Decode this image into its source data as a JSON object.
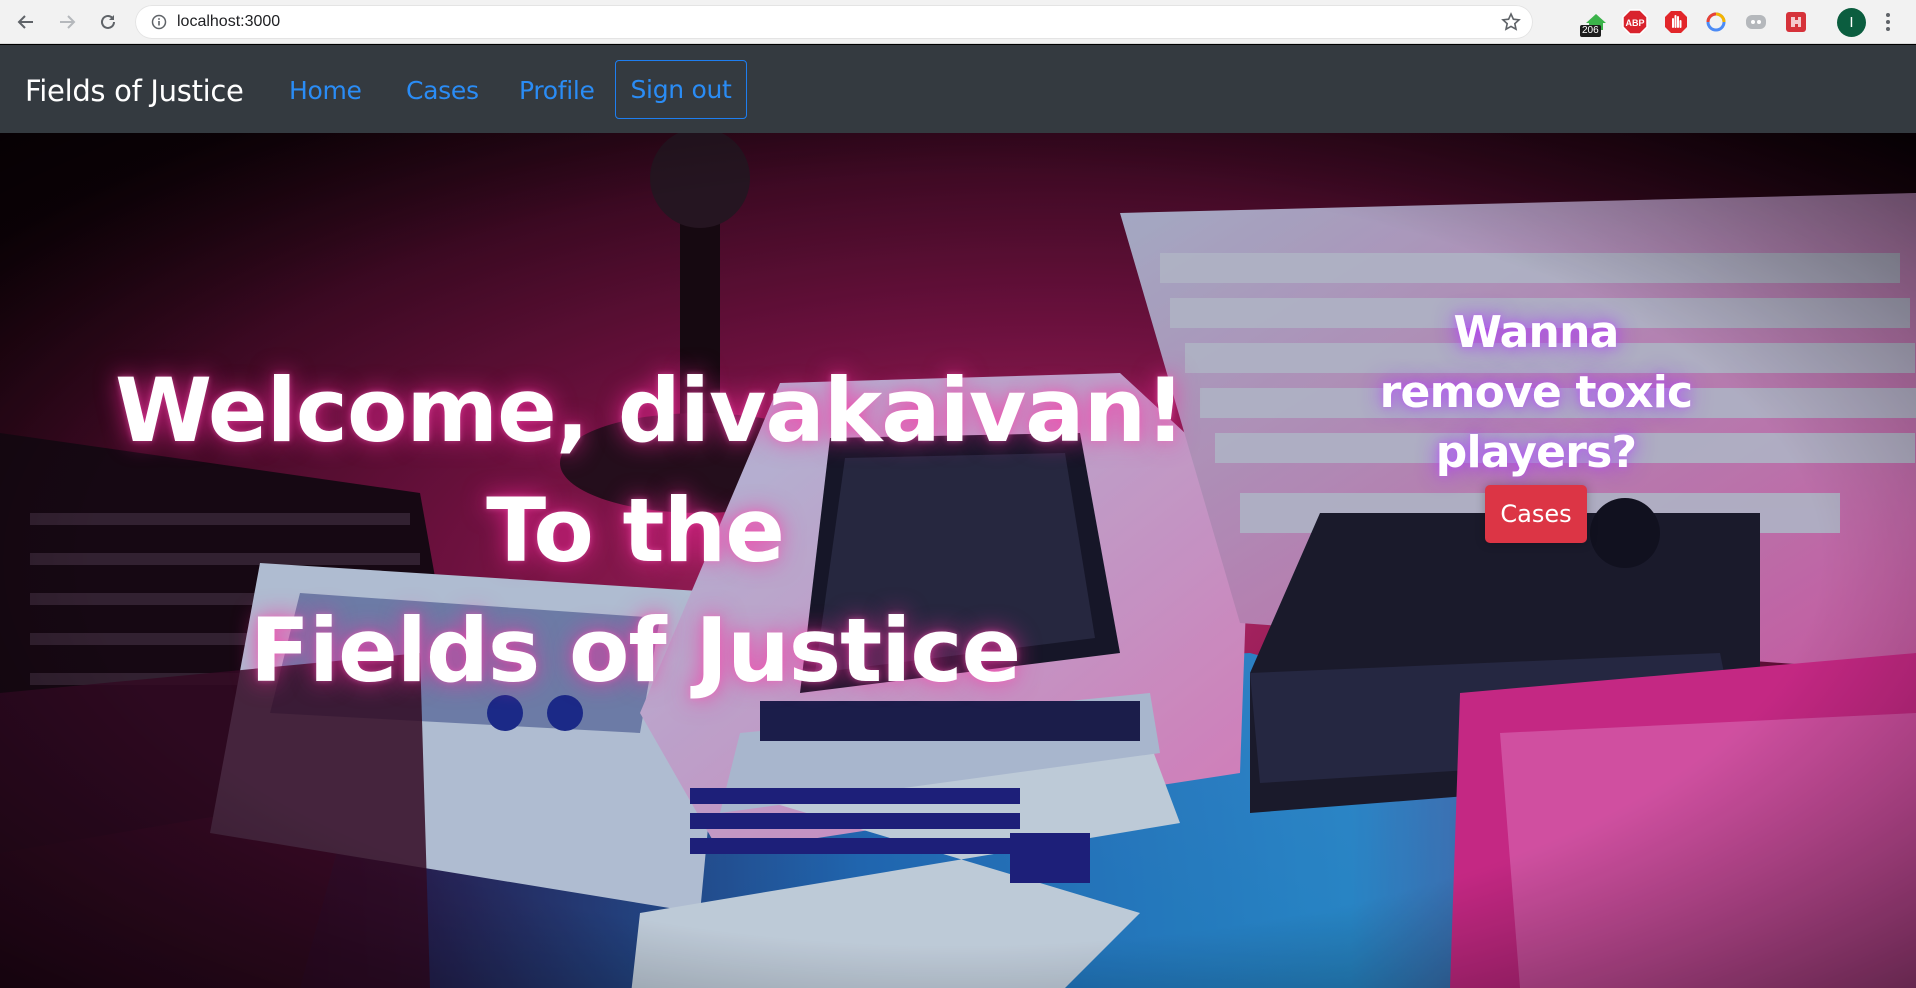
{
  "browser": {
    "url": "localhost:3000",
    "extension_badge": "206",
    "profile_initial": "I"
  },
  "navbar": {
    "brand": "Fields of Justice",
    "links": [
      "Home",
      "Cases",
      "Profile"
    ],
    "signout_label": "Sign out"
  },
  "hero": {
    "welcome_lines": [
      "Welcome, divakaivan!",
      "To the",
      "Fields of Justice"
    ],
    "cta_lines": [
      "Wanna",
      "remove toxic",
      "players?"
    ],
    "cta_button": "Cases"
  },
  "colors": {
    "navbar_bg": "#343a40",
    "nav_link": "#2a8cf5",
    "cta_button_bg": "#dc3545"
  }
}
